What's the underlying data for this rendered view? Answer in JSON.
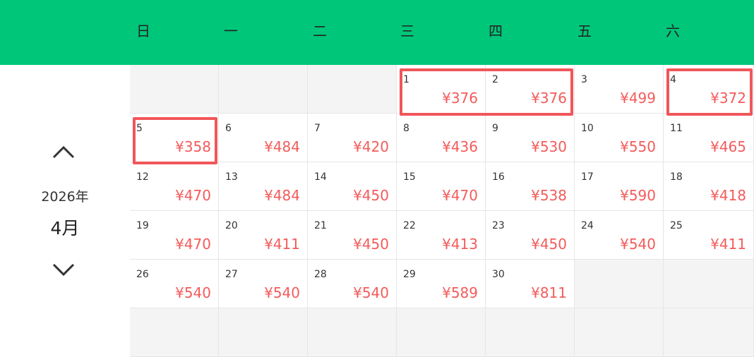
{
  "weekdays": [
    "日",
    "一",
    "二",
    "三",
    "四",
    "五",
    "六"
  ],
  "nav": {
    "year": "2026年",
    "month": "4月"
  },
  "days": [
    {
      "day": "1",
      "price": "¥376"
    },
    {
      "day": "2",
      "price": "¥376"
    },
    {
      "day": "3",
      "price": "¥499"
    },
    {
      "day": "4",
      "price": "¥372"
    },
    {
      "day": "5",
      "price": "¥358"
    },
    {
      "day": "6",
      "price": "¥484"
    },
    {
      "day": "7",
      "price": "¥420"
    },
    {
      "day": "8",
      "price": "¥436"
    },
    {
      "day": "9",
      "price": "¥530"
    },
    {
      "day": "10",
      "price": "¥550"
    },
    {
      "day": "11",
      "price": "¥465"
    },
    {
      "day": "12",
      "price": "¥470"
    },
    {
      "day": "13",
      "price": "¥484"
    },
    {
      "day": "14",
      "price": "¥450"
    },
    {
      "day": "15",
      "price": "¥470"
    },
    {
      "day": "16",
      "price": "¥538"
    },
    {
      "day": "17",
      "price": "¥590"
    },
    {
      "day": "18",
      "price": "¥418"
    },
    {
      "day": "19",
      "price": "¥470"
    },
    {
      "day": "20",
      "price": "¥411"
    },
    {
      "day": "21",
      "price": "¥450"
    },
    {
      "day": "22",
      "price": "¥413"
    },
    {
      "day": "23",
      "price": "¥450"
    },
    {
      "day": "24",
      "price": "¥540"
    },
    {
      "day": "25",
      "price": "¥411"
    },
    {
      "day": "26",
      "price": "¥540"
    },
    {
      "day": "27",
      "price": "¥540"
    },
    {
      "day": "28",
      "price": "¥540"
    },
    {
      "day": "29",
      "price": "¥589"
    },
    {
      "day": "30",
      "price": "¥811"
    }
  ],
  "highlighted_days": [
    [
      "1",
      "2"
    ],
    [
      "4"
    ],
    [
      "5"
    ]
  ],
  "colors": {
    "header": "#00c67a",
    "price": "#f45b5b",
    "highlight": "#f0565a",
    "empty_cell": "#f4f4f4"
  }
}
